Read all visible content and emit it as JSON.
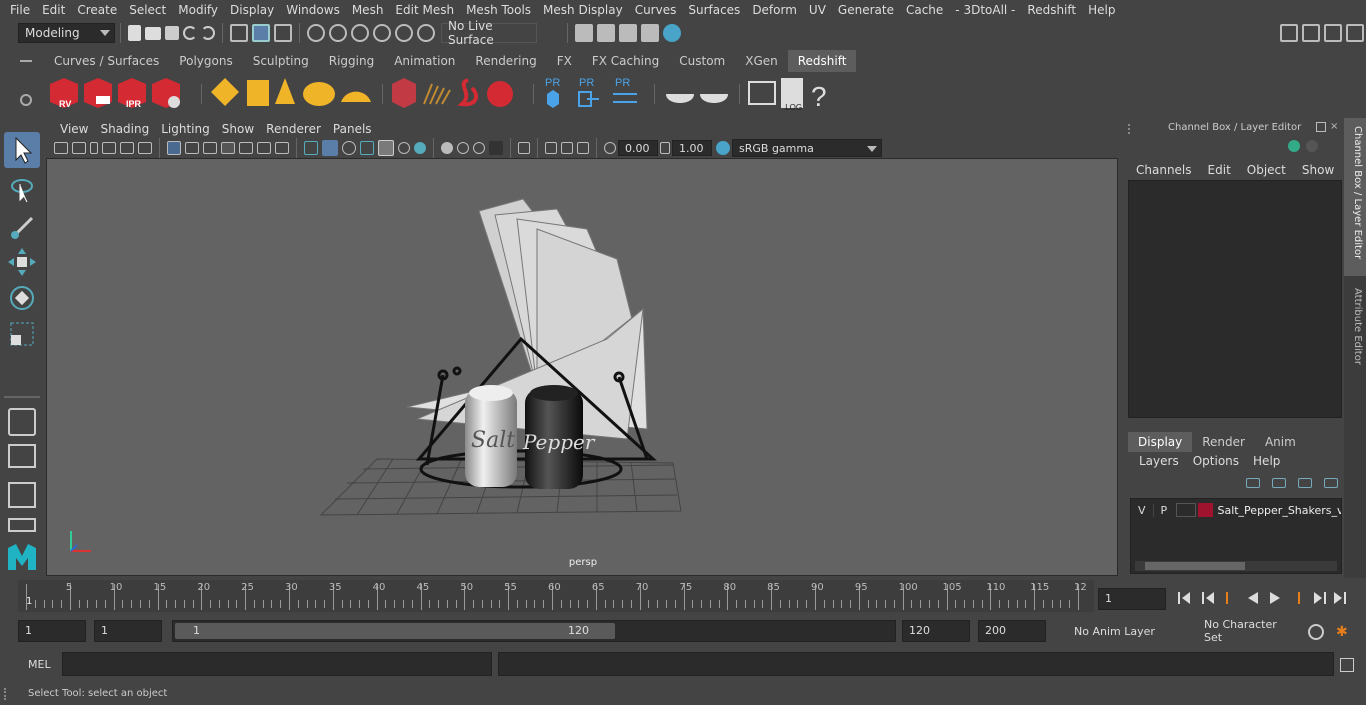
{
  "menubar": [
    "File",
    "Edit",
    "Create",
    "Select",
    "Modify",
    "Display",
    "Windows",
    "Mesh",
    "Edit Mesh",
    "Mesh Tools",
    "Mesh Display",
    "Curves",
    "Surfaces",
    "Deform",
    "UV",
    "Generate",
    "Cache",
    "- 3DtoAll -",
    "Redshift",
    "Help"
  ],
  "status": {
    "mode": "Modeling",
    "live_surface": "No Live Surface"
  },
  "shelf_tabs": [
    "Curves / Surfaces",
    "Polygons",
    "Sculpting",
    "Rigging",
    "Animation",
    "Rendering",
    "FX",
    "FX Caching",
    "Custom",
    "XGen",
    "Redshift"
  ],
  "shelf_active": "Redshift",
  "shelf_labels": {
    "rv": "RV",
    "ipr": "IPR",
    "pr1": "PR",
    "pr2": "PR",
    "pr3": "PR",
    "log": ".LOG",
    "help": "?"
  },
  "viewport": {
    "menus": [
      "View",
      "Shading",
      "Lighting",
      "Show",
      "Renderer",
      "Panels"
    ],
    "exposure": "0.00",
    "gamma": "1.00",
    "colorspace": "sRGB gamma",
    "camera": "persp",
    "salt_label": "Salt",
    "pepper_label": "Pepper"
  },
  "channel_box": {
    "title": "Channel Box / Layer Editor",
    "menus": [
      "Channels",
      "Edit",
      "Object",
      "Show"
    ]
  },
  "layer_editor": {
    "tabs": [
      "Display",
      "Render",
      "Anim"
    ],
    "active_tab": "Display",
    "menus": [
      "Layers",
      "Options",
      "Help"
    ],
    "layer": {
      "v": "V",
      "p": "P",
      "name": "Salt_Pepper_Shakers_v",
      "color": "#a0132e"
    }
  },
  "side_tabs": {
    "channel": "Channel Box / Layer Editor",
    "attribute": "Attribute Editor"
  },
  "timeline": {
    "ticks": [
      "5",
      "10",
      "15",
      "20",
      "25",
      "30",
      "35",
      "40",
      "45",
      "50",
      "55",
      "60",
      "65",
      "70",
      "75",
      "80",
      "85",
      "90",
      "95",
      "100",
      "105",
      "110",
      "115",
      "12"
    ],
    "start_marker": "1",
    "current_frame": "1"
  },
  "range": {
    "start": "1",
    "playback_start": "1",
    "slider_start": "1",
    "slider_end": "120",
    "end": "120",
    "anim_end": "200",
    "anim_layer": "No Anim Layer",
    "character_set": "No Character Set"
  },
  "cmd": {
    "lang": "MEL"
  },
  "help": {
    "text": "Select Tool: select an object"
  }
}
